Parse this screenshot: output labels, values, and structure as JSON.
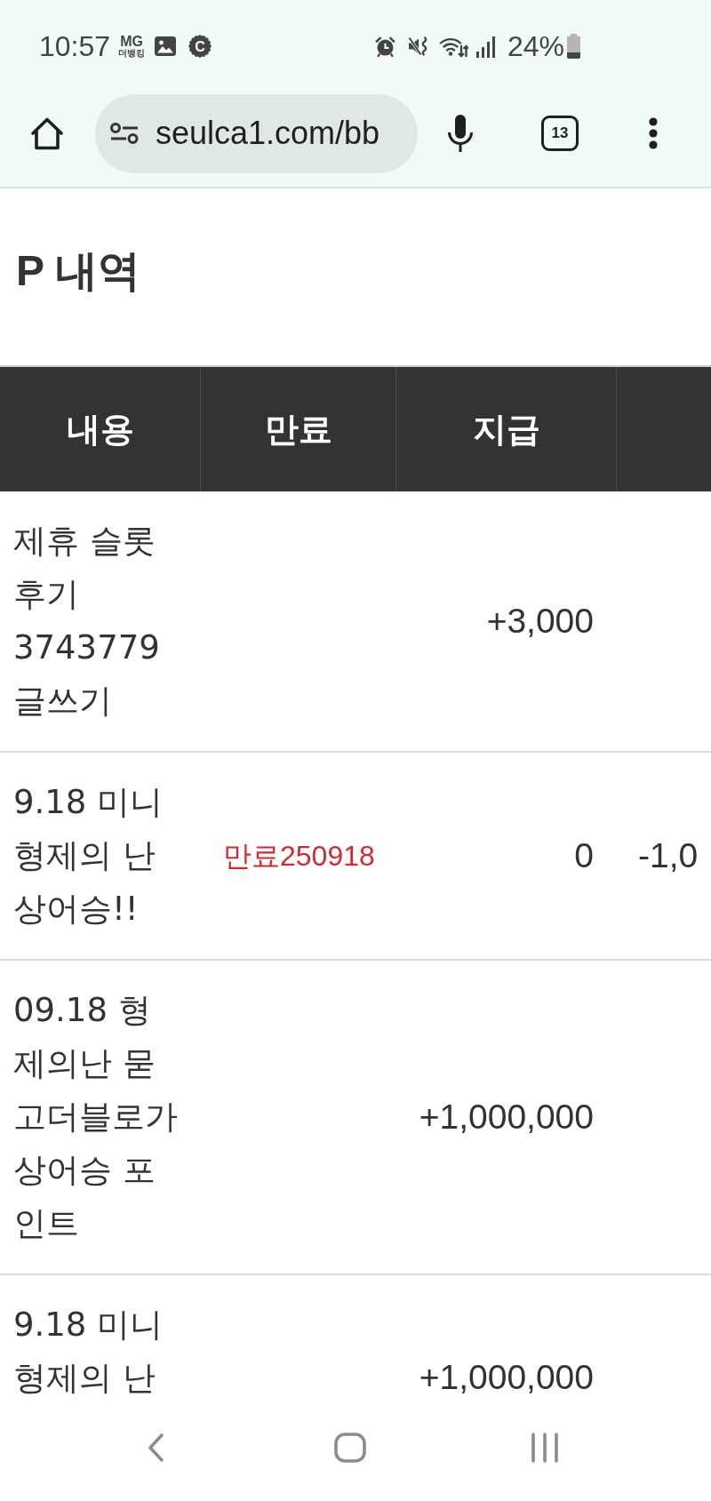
{
  "status_bar": {
    "time": "10:57",
    "app_logo": {
      "top": "MG",
      "bottom": "더뱅킹"
    },
    "notification_letter": "C",
    "battery": "24%"
  },
  "browser": {
    "url": "seulca1.com/bb",
    "tab_count": "13"
  },
  "page": {
    "title": "P 내역"
  },
  "table": {
    "columns": [
      "내용",
      "만료",
      "지급"
    ],
    "rows": [
      {
        "content": "제휴 슬롯 후기 3743779 글쓰기",
        "paid": "+3,000"
      },
      {
        "content": "9.18 미니 형제의 난 상어승!!",
        "expiry": "만료250918",
        "paid": "0",
        "column_4": "-1,0"
      },
      {
        "content": "09.18 형제의난 묻고더블로가 상어승 포인트",
        "paid": "+1,000,000"
      },
      {
        "content": "9.18 미니 형제의 난",
        "paid": "+1,000,000"
      }
    ]
  }
}
